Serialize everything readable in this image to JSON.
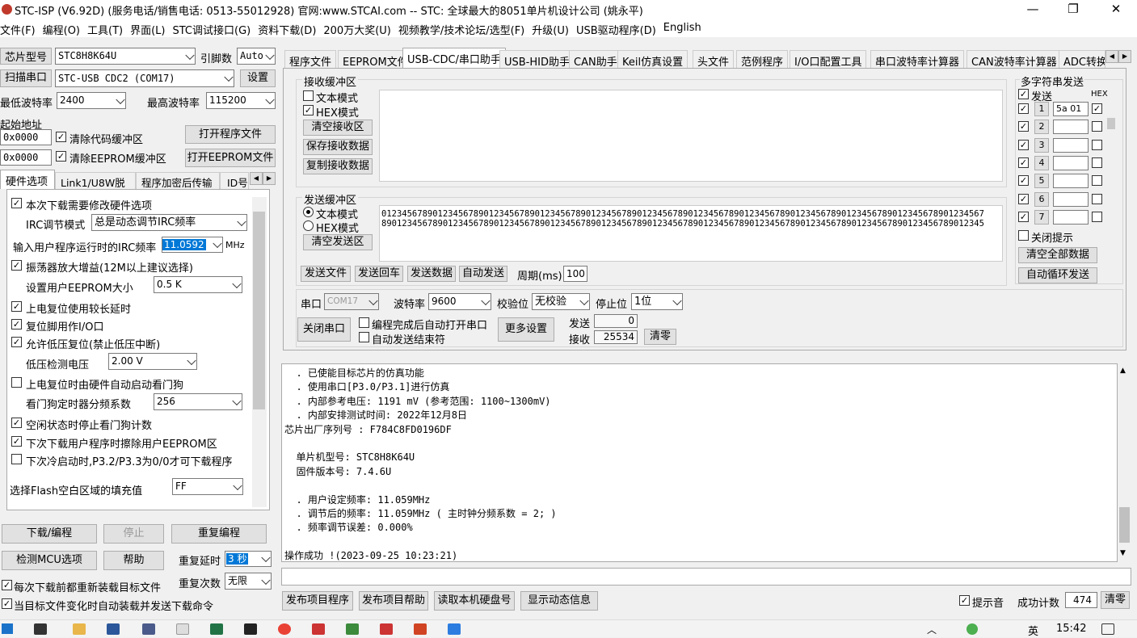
{
  "title": "STC-ISP (V6.92D) (服务电话/销售电话: 0513-55012928) 官网:www.STCAI.com  -- STC: 全球最大的8051单片机设计公司 (姚永平)",
  "window": {
    "min": "—",
    "max": "❐",
    "close": "✕"
  },
  "menu": [
    "文件(F)",
    "编程(O)",
    "工具(T)",
    "界面(L)",
    "STC调试接口(G)",
    "资料下载(D)",
    "200万大奖(U)",
    "视频教学/技术论坛/选型(F)",
    "升级(U)",
    "USB驱动程序(D)",
    "English"
  ],
  "left": {
    "chip_label": "芯片型号",
    "chip_value": "STC8H8K64U",
    "pin_label": "引脚数",
    "pin_value": "Auto",
    "scan_label": "扫描串口",
    "port_value": "STC-USB CDC2 (COM17)",
    "settings": "设置",
    "min_baud_label": "最低波特率",
    "min_baud": "2400",
    "max_baud_label": "最高波特率",
    "max_baud": "115200",
    "start_addr_label": "起始地址",
    "addr1": "0x0000",
    "clear_code": "清除代码缓冲区",
    "open_prog": "打开程序文件",
    "addr2": "0x0000",
    "clear_eeprom": "清除EEPROM缓冲区",
    "open_eeprom": "打开EEPROM文件",
    "tabs": [
      "硬件选项",
      "Link1/U8W脱机",
      "程序加密后传输",
      "ID号"
    ],
    "options": {
      "o1": "本次下载需要修改硬件选项",
      "irc_mode_label": "IRC调节模式",
      "irc_mode": "总是动态调节IRC频率",
      "irc_freq_label": "输入用户程序运行时的IRC频率",
      "irc_freq": "11.0592",
      "mhz": "MHz",
      "o2": "振荡器放大增益(12M以上建议选择)",
      "eeprom_label": "设置用户EEPROM大小",
      "eeprom": "0.5 K",
      "o3": "上电复位使用较长延时",
      "o4": "复位脚用作I/O口",
      "o5": "允许低压复位(禁止低压中断)",
      "lv_label": "低压检测电压",
      "lv": "2.00 V",
      "o6": "上电复位时由硬件自动启动看门狗",
      "wdt_label": "看门狗定时器分频系数",
      "wdt": "256",
      "o7": "空闲状态时停止看门狗计数",
      "o8": "下次下载用户程序时擦除用户EEPROM区",
      "o9": "下次冷启动时,P3.2/P3.3为0/0才可下载程序",
      "fill_label": "选择Flash空白区域的填充值",
      "fill": "FF"
    },
    "download": "下载/编程",
    "stop": "停止",
    "reprog": "重复编程",
    "detect": "检测MCU选项",
    "help": "帮助",
    "delay_label": "重复延时",
    "delay": "3 秒",
    "count_label": "重复次数",
    "count": "无限",
    "reload": "每次下载前都重新装载目标文件",
    "autoload": "当目标文件变化时自动装载并发送下载命令"
  },
  "tabs": [
    "程序文件",
    "EEPROM文件",
    "USB-CDC/串口助手",
    "USB-HID助手",
    "CAN助手",
    "Keil仿真设置",
    "头文件",
    "范例程序",
    "I/O口配置工具",
    "串口波特率计算器",
    "CAN波特率计算器",
    "ADC转换"
  ],
  "recv": {
    "title": "接收缓冲区",
    "text_mode": "文本模式",
    "hex_mode": "HEX模式",
    "clear": "清空接收区",
    "save": "保存接收数据",
    "copy": "复制接收数据"
  },
  "send": {
    "title": "发送缓冲区",
    "text_mode": "文本模式",
    "hex_mode": "HEX模式",
    "clear": "清空发送区",
    "content": "01234567890123456789012345678901234567890123456789012345678901234567890123456789012345678901234567890123456789012345678901234567890123456789012345678901234567890123456789012345678901234567890123456789012345678901234567890123456789012345",
    "send_file": "发送文件",
    "send_return": "发送回车",
    "send_data": "发送数据",
    "auto_send": "自动发送",
    "period_label": "周期(ms)",
    "period": "100"
  },
  "serial": {
    "port_label": "串口",
    "port": "COM17",
    "baud_label": "波特率",
    "baud": "9600",
    "parity_label": "校验位",
    "parity": "无校验",
    "stop_label": "停止位",
    "stop": "1位",
    "close": "关闭串口",
    "auto_open": "编程完成后自动打开串口",
    "auto_end": "自动发送结束符",
    "more": "更多设置",
    "sent_label": "发送",
    "sent": "0",
    "recv_label": "接收",
    "recv": "25534",
    "clear": "清零"
  },
  "multi": {
    "title": "多字符串发送",
    "send_label": "发送",
    "hex_label": "HEX",
    "rows": [
      {
        "n": "1",
        "v": "5a 01"
      },
      {
        "n": "2",
        "v": ""
      },
      {
        "n": "3",
        "v": ""
      },
      {
        "n": "4",
        "v": ""
      },
      {
        "n": "5",
        "v": ""
      },
      {
        "n": "6",
        "v": ""
      },
      {
        "n": "7",
        "v": ""
      }
    ],
    "close_hint": "关闭提示",
    "clear_all": "清空全部数据",
    "auto_loop": "自动循环发送"
  },
  "log": [
    "  . 已使能目标芯片的仿真功能",
    "  . 使用串口[P3.0/P3.1]进行仿真",
    "  . 内部参考电压: 1191 mV (参考范围: 1100~1300mV)",
    "  . 内部安排测试时间: 2022年12月8日",
    "芯片出厂序列号 : F784C8FD0196DF",
    "",
    "  单片机型号: STC8H8K64U",
    "  固件版本号: 7.4.6U",
    "",
    "  . 用户设定频率: 11.059MHz",
    "  . 调节后的频率: 11.059MHz ( 主时钟分频系数 = 2; )",
    "  . 频率调节误差: 0.000%",
    "",
    "操作成功 !(2023-09-25 10:23:21)"
  ],
  "bottom": {
    "publish": "发布项目程序",
    "publish_help": "发布项目帮助",
    "read_disk": "读取本机硬盘号",
    "show_dyn": "显示动态信息",
    "beep": "提示音",
    "success_label": "成功计数",
    "success": "474",
    "clear": "清零"
  },
  "taskbar": {
    "time": "15:42",
    "ime": "英"
  }
}
